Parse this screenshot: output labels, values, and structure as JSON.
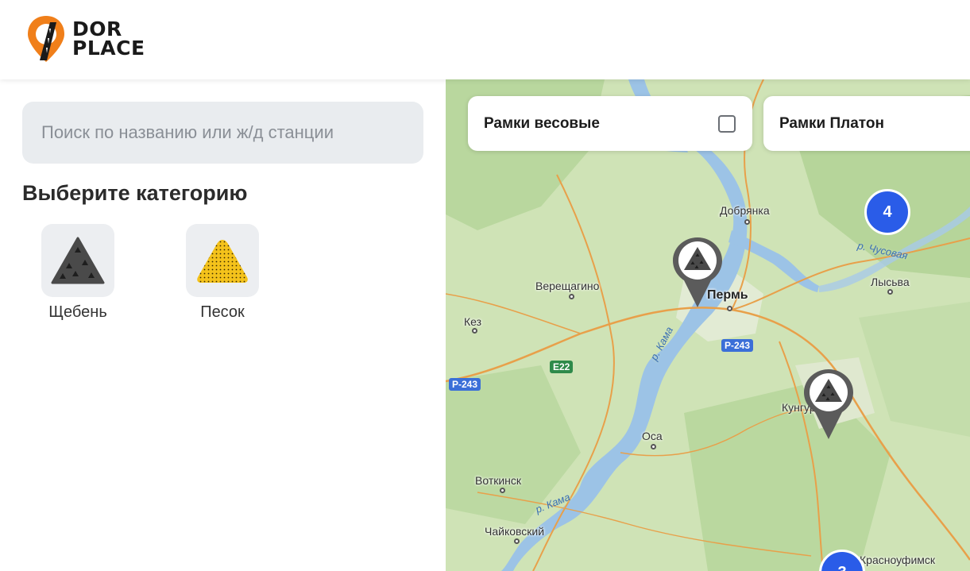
{
  "header": {
    "logo_line1": "DOR",
    "logo_line2": "PLACE"
  },
  "sidebar": {
    "search_placeholder": "Поиск по названию или ж/д станции",
    "category_title": "Выберите категорию",
    "categories": [
      {
        "label": "Щебень",
        "icon": "crushed-stone-icon"
      },
      {
        "label": "Песок",
        "icon": "sand-icon"
      }
    ]
  },
  "map": {
    "filters": [
      {
        "label": "Рамки весовые",
        "checked": false
      },
      {
        "label": "Рамки Платон"
      }
    ],
    "places": {
      "dobryanka": "Добрянка",
      "vereshchagino": "Верещагино",
      "perm": "Пермь",
      "lysva": "Лысьва",
      "kez": "Кез",
      "kungur": "Кунгур",
      "osa": "Оса",
      "votkinsk": "Воткинск",
      "chaykovsky": "Чайковский",
      "krasnoufimsk": "Красноуфимск"
    },
    "rivers": {
      "kama1": "р. Кама",
      "kama2": "р. Кама",
      "chusovaya": "р. Чусовая"
    },
    "roads": {
      "r243a": "Р-243",
      "r243b": "Р-243",
      "e22": "E22"
    },
    "clusters": {
      "c1": "4",
      "c2": "3"
    }
  },
  "colors": {
    "accent": "#f07f1a",
    "cluster": "#2a5ce8",
    "sand": "#f4c21b",
    "stone": "#4a4a4a"
  }
}
